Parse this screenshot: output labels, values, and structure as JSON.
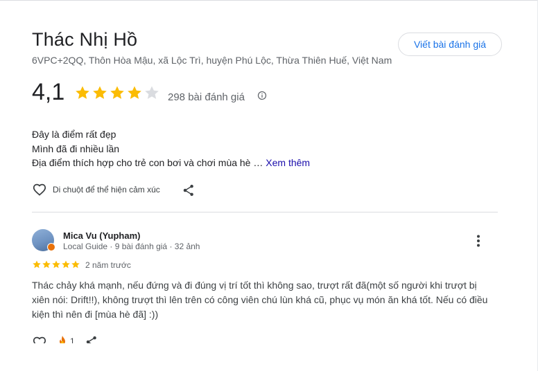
{
  "place": {
    "title": "Thác Nhị Hồ",
    "address": "6VPC+2QQ, Thôn Hòa Mậu, xã Lộc Trì, huyện Phú Lộc, Thừa Thiên Huế, Việt Nam",
    "write_review_label": "Viết bài đánh giá"
  },
  "rating": {
    "value": "4,1",
    "stars": 4.1,
    "count_label": "298 bài đánh giá",
    "star_color": "#fbbc04",
    "empty_star_color": "#dadce0"
  },
  "description": {
    "line1": "Đây là điểm rất đẹp",
    "line2": "Mình đã đi nhiều lần",
    "line3": "Địa điểm thích hợp cho trẻ con bơi và chơi mùa hè …",
    "more_label": "Xem thêm"
  },
  "reactions": {
    "hint": "Di chuột để thể hiện cảm xúc"
  },
  "review": {
    "author": "Mica Vu (Yupham)",
    "meta": "Local Guide · 9 bài đánh giá · 32 ảnh",
    "stars": 5,
    "time_ago": "2 năm trước",
    "text": "Thác chảy khá mạnh, nếu đứng và đi đúng vị trí tốt thì không sao, trượt rất đã(một số người khi trượt bị xiên nói: Drift!!), không trượt thì lên trên có công viên chú lùn khá cũ, phục vụ món ăn khá tốt. Nếu có điều kiện thì nên đi [mùa hè đã] :))",
    "reaction_count": "1"
  },
  "icons": {
    "heart": "heart-outline-icon",
    "share": "share-icon",
    "info": "info-icon",
    "more": "more-vert-icon",
    "fire": "fire-reaction-icon"
  }
}
